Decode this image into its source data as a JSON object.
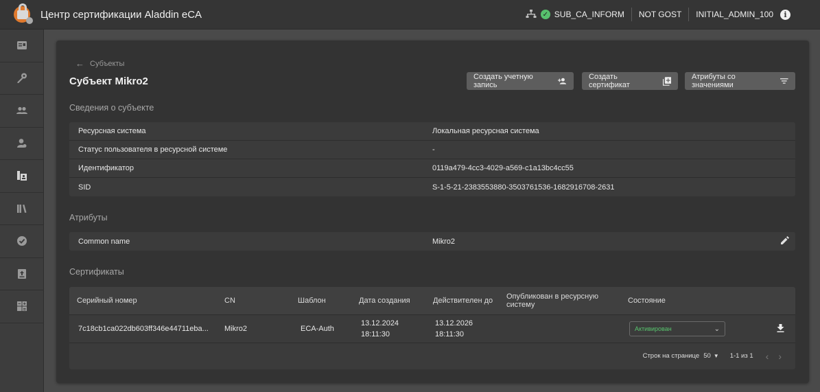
{
  "header": {
    "app_title": "Центр сертификации Aladdin eCA",
    "ca_name": "SUB_CA_INFORM",
    "mode": "NOT GOST",
    "user": "INITIAL_ADMIN_100",
    "info_glyph": "i"
  },
  "sidebar": {
    "items": [
      {
        "name": "id-card-icon"
      },
      {
        "name": "key-icon"
      },
      {
        "name": "users-icon"
      },
      {
        "name": "user-certificate-icon"
      },
      {
        "name": "subjects-icon"
      },
      {
        "name": "library-icon"
      },
      {
        "name": "check-badge-icon"
      },
      {
        "name": "upload-document-icon"
      },
      {
        "name": "calculator-icon"
      }
    ]
  },
  "page": {
    "back_label": "Субъекты",
    "title": "Субъект Mikro2",
    "buttons": {
      "create_account": "Создать учетную запись",
      "create_certificate": "Создать сертификат",
      "attributes_with_values": "Атрибуты со значениями"
    }
  },
  "subject_info": {
    "section_title": "Сведения о субъекте",
    "rows": [
      {
        "key": "Ресурсная система",
        "value": "Локальная ресурсная система"
      },
      {
        "key": "Статус пользователя в ресурсной системе",
        "value": "-"
      },
      {
        "key": "Идентификатор",
        "value": "0119a479-4cc3-4029-a569-c1a13bc4cc55"
      },
      {
        "key": "SID",
        "value": "S-1-5-21-2383553880-3503761536-1682916708-2631"
      }
    ]
  },
  "attributes": {
    "section_title": "Атрибуты",
    "rows": [
      {
        "key": "Common name",
        "value": "Mikro2"
      }
    ]
  },
  "certificates": {
    "section_title": "Сертификаты",
    "columns": [
      "Серийный номер",
      "CN",
      "Шаблон",
      "Дата создания",
      "Действителен до",
      "Опубликован в ресурсную систему",
      "Состояние"
    ],
    "rows": [
      {
        "serial": "7c18cb1ca022db603ff346e44711eba...",
        "cn": "Mikro2",
        "template": "ECA-Auth",
        "created_date": "13.12.2024",
        "created_time": "18:11:30",
        "valid_date": "13.12.2026",
        "valid_time": "18:11:30",
        "published": "",
        "status": "Активирован"
      }
    ],
    "pager": {
      "rows_per_page_label": "Строк на странице",
      "rows_per_page": "50",
      "range": "1-1 из 1"
    }
  },
  "colors": {
    "status_active": "#58c46e",
    "ok_badge": "#57c06d",
    "logo_accent": "#e07a2e"
  }
}
